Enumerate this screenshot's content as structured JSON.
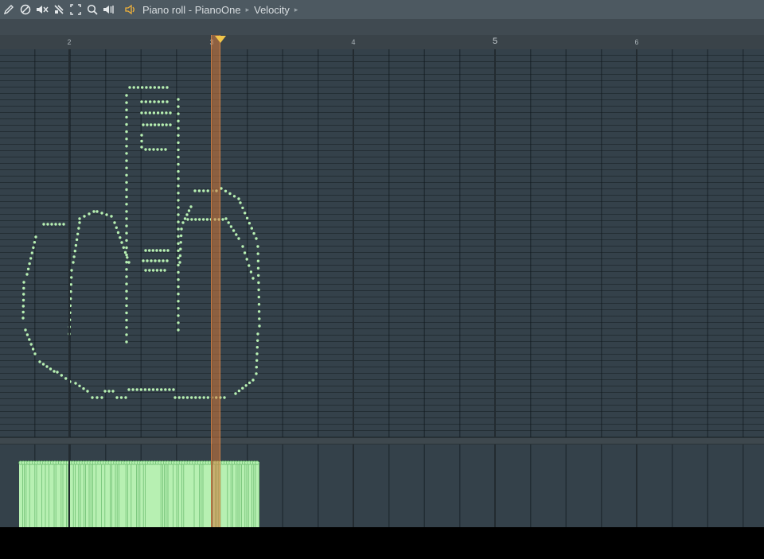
{
  "toolbar": {
    "tools": [
      {
        "name": "draw-tool-icon",
        "glyph": "✎"
      },
      {
        "name": "delete-tool-icon",
        "glyph": "⊘"
      },
      {
        "name": "mute-tool-icon",
        "glyph": "🔇"
      },
      {
        "name": "slice-tool-icon",
        "glyph": "⧄"
      },
      {
        "name": "select-tool-icon",
        "glyph": "⛶"
      },
      {
        "name": "zoom-tool-icon",
        "glyph": "⌕"
      },
      {
        "name": "playback-tool-icon",
        "glyph": "◀"
      }
    ],
    "breadcrumb": {
      "title": "Piano roll - PianoOne",
      "param": "Velocity",
      "arrow": "▸"
    }
  },
  "ruler": {
    "bars": [
      {
        "label": "2",
        "major": false
      },
      {
        "label": "3",
        "major": false
      },
      {
        "label": "4",
        "major": false
      },
      {
        "label": "5",
        "major": true
      },
      {
        "label": "6",
        "major": false
      }
    ]
  },
  "colors": {
    "note": "#b7f0b2",
    "note_border": "#6fbf73",
    "grid_bg": "#34414a",
    "playhead": "#d67a3a",
    "marker": "#f1c54a"
  }
}
